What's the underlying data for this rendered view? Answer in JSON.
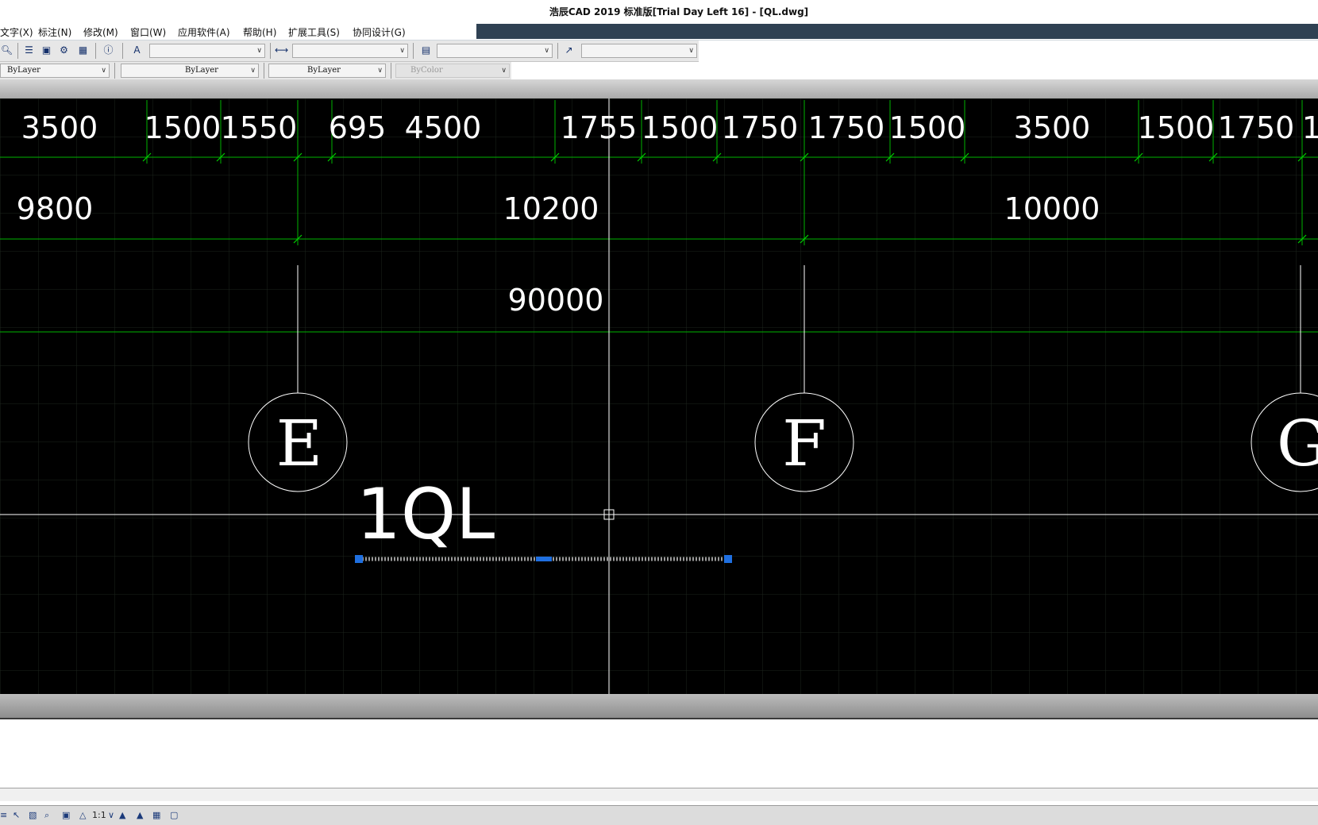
{
  "title": "浩辰CAD 2019 标准版[Trial Day Left 16] - [QL.dwg]",
  "menu": [
    {
      "label": "文字(X)"
    },
    {
      "label": "标注(N)"
    },
    {
      "label": "修改(M)"
    },
    {
      "label": "窗口(W)"
    },
    {
      "label": "应用软件(A)"
    },
    {
      "label": "帮助(H)"
    },
    {
      "label": "扩展工具(S)"
    },
    {
      "label": "协同设计(G)"
    }
  ],
  "toolbar": {
    "text_style": "",
    "dim_style": "",
    "table_style": "",
    "multileader_style": ""
  },
  "properties": {
    "layer": "ByLayer",
    "linetype": "ByLayer",
    "lineweight": "ByLayer",
    "plotstyle": "ByColor"
  },
  "drawing": {
    "dims_row1": [
      "3500",
      "1500",
      "1550",
      "695",
      "4500",
      "1755",
      "1500",
      "1750",
      "1750",
      "1500",
      "3500",
      "1500",
      "1750",
      "1"
    ],
    "dims_row2": [
      "9800",
      "10200",
      "10000"
    ],
    "dims_row3": [
      "90000"
    ],
    "axis_labels": [
      "E",
      "F",
      "G"
    ],
    "wall_label": "1QL"
  },
  "status": {
    "scale": "1:1"
  },
  "colors": {
    "canvas_bg": "#000000",
    "dimension": "#00c000",
    "entity": "#ffffff",
    "grip": "#1f6fe0"
  }
}
